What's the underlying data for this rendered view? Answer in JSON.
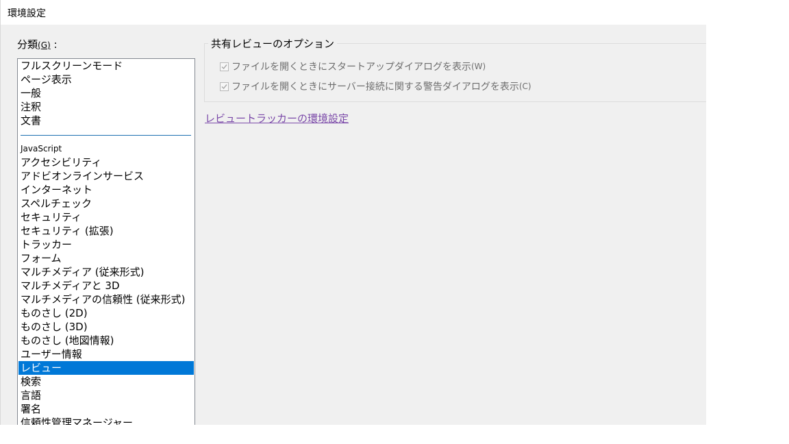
{
  "window": {
    "title": "環境設定"
  },
  "category": {
    "label": "分類",
    "accelerator": "(G)",
    "colon": " :",
    "top_items": [
      "フルスクリーンモード",
      "ページ表示",
      "一般",
      "注釈",
      "文書"
    ],
    "items": [
      "JavaScript",
      "アクセシビリティ",
      "アドビオンラインサービス",
      "インターネット",
      "スペルチェック",
      "セキュリティ",
      "セキュリティ (拡張)",
      "トラッカー",
      "フォーム",
      "マルチメディア (従来形式)",
      "マルチメディアと 3D",
      "マルチメディアの信頼性 (従来形式)",
      "ものさし (2D)",
      "ものさし (3D)",
      "ものさし (地図情報)",
      "ユーザー情報",
      "レビュー",
      "検索",
      "言語",
      "署名",
      "信頼性管理マネージャー"
    ],
    "selected": "レビュー"
  },
  "shared_review": {
    "title": "共有レビューのオプション",
    "options": [
      {
        "label": "ファイルを開くときにスタートアップダイアログを表示",
        "accelerator": "(W)",
        "checked": true,
        "enabled": false
      },
      {
        "label": "ファイルを開くときにサーバー接続に関する警告ダイアログを表示",
        "accelerator": "(C)",
        "checked": true,
        "enabled": false
      }
    ]
  },
  "tracker_link": "レビュートラッカーの環境設定",
  "colors": {
    "selection": "#0078d7",
    "link": "#7a48a8",
    "disabled_text": "#6d6d6d",
    "panel_bg": "#f0f0f0"
  }
}
